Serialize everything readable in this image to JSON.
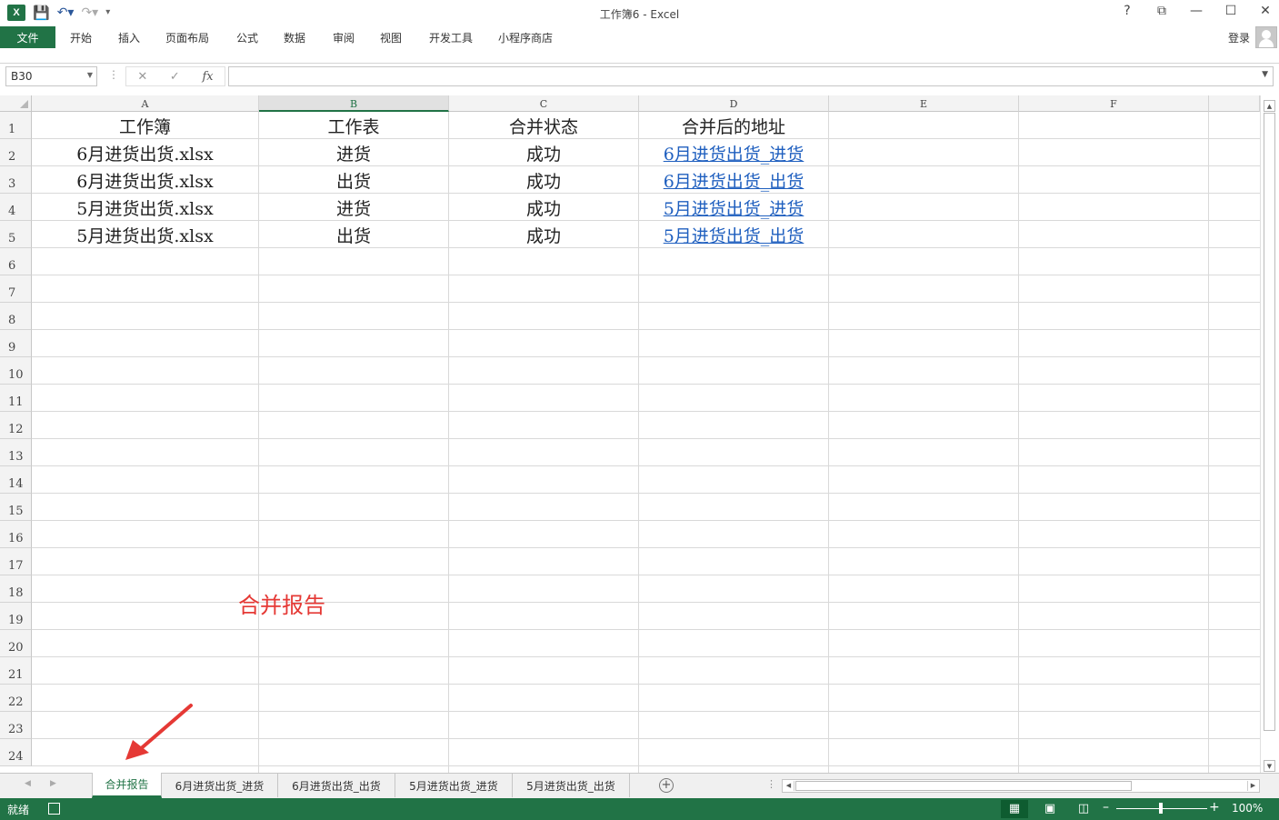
{
  "window": {
    "title": "工作簿6 - Excel",
    "help": "?",
    "restore_ribbon": "⧉",
    "minimize": "—",
    "maximize": "☐",
    "close": "✕"
  },
  "qat": {
    "logo": "X",
    "save_icon": "save-icon",
    "undo_icon": "undo-icon",
    "redo_icon": "redo-icon"
  },
  "ribbon": {
    "file": "文件",
    "tabs": [
      "开始",
      "插入",
      "页面布局",
      "公式",
      "数据",
      "审阅",
      "视图",
      "开发工具",
      "小程序商店"
    ],
    "login": "登录"
  },
  "formula_bar": {
    "name_box": "B30",
    "cancel": "✕",
    "enter": "✓",
    "fx": "fx",
    "value": ""
  },
  "grid": {
    "columns": [
      "A",
      "B",
      "C",
      "D",
      "E",
      "F"
    ],
    "selected_column": "B",
    "rows": [
      "1",
      "2",
      "3",
      "4",
      "5",
      "6",
      "7",
      "8",
      "9",
      "10",
      "11",
      "12",
      "13",
      "14",
      "15",
      "16",
      "17",
      "18",
      "19",
      "20",
      "21",
      "22",
      "23",
      "24"
    ],
    "header": [
      "工作簿",
      "工作表",
      "合并状态",
      "合并后的地址"
    ],
    "data": [
      [
        "6月进货出货.xlsx",
        "进货",
        "成功",
        "6月进货出货_进货"
      ],
      [
        "6月进货出货.xlsx",
        "出货",
        "成功",
        "6月进货出货_出货"
      ],
      [
        "5月进货出货.xlsx",
        "进货",
        "成功",
        "5月进货出货_进货"
      ],
      [
        "5月进货出货.xlsx",
        "出货",
        "成功",
        "5月进货出货_出货"
      ]
    ]
  },
  "annotation": {
    "text": "合并报告",
    "color": "#e53935"
  },
  "sheets": {
    "tabs": [
      "合并报告",
      "6月进货出货_进货",
      "6月进货出货_出货",
      "5月进货出货_进货",
      "5月进货出货_出货"
    ],
    "active": "合并报告"
  },
  "status": {
    "ready": "就绪",
    "zoom": "100%"
  },
  "colors": {
    "accent": "#217346",
    "link": "#1f5fbf"
  }
}
